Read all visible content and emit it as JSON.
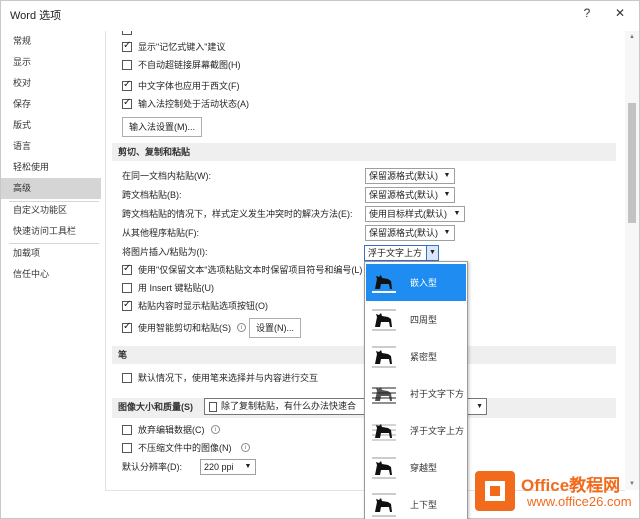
{
  "window": {
    "title": "Word 选项",
    "help": "?",
    "close": "✕"
  },
  "sidebar": {
    "items": [
      {
        "label": "常规"
      },
      {
        "label": "显示"
      },
      {
        "label": "校对"
      },
      {
        "label": "保存"
      },
      {
        "label": "版式"
      },
      {
        "label": "语言"
      },
      {
        "label": "轻松使用"
      },
      {
        "label": "高级",
        "active": true
      },
      {
        "label": "自定义功能区"
      },
      {
        "label": "快速访问工具栏"
      },
      {
        "label": "加载项"
      },
      {
        "label": "信任中心"
      }
    ]
  },
  "options": {
    "show_autocomplete": "显示\"记忆式键入\"建议",
    "no_auto_hyperlink_screenshot": "不自动超链接屏幕截图(H)",
    "chinese_font_western": "中文字体也应用于西文(F)",
    "ime_control_active": "输入法控制处于活动状态(A)",
    "ime_settings_button": "输入法设置(M)..."
  },
  "cut_copy_paste": {
    "heading": "剪切、复制和粘贴",
    "rows": [
      {
        "label": "在同一文档内粘贴(W):",
        "value": "保留源格式(默认)"
      },
      {
        "label": "跨文档粘贴(B):",
        "value": "保留源格式(默认)"
      },
      {
        "label": "跨文档粘贴的情况下，样式定义发生冲突时的解决方法(E):",
        "value": "使用目标样式(默认)"
      },
      {
        "label": "从其他程序粘贴(F):",
        "value": "保留源格式(默认)"
      }
    ],
    "insert_picture_label": "将图片插入/粘贴为(I):",
    "insert_picture_value": "浮于文字上方",
    "keep_bullets": "使用\"仅保留文本\"选项粘贴文本时保留项目符号和编号(L)",
    "insert_key_paste": "用 Insert 键粘贴(U)",
    "show_paste_options": "粘贴内容时显示粘贴选项按钮(O)",
    "smart_cut_paste": "使用智能剪切和粘贴(S)",
    "settings_button": "设置(N)..."
  },
  "pen": {
    "heading": "笔",
    "default_select": "默认情况下，使用笔来选择并与内容进行交互"
  },
  "image_size_quality": {
    "heading": "图像大小和质量(S)",
    "doc_value": "除了复制粘贴，有什么办法快速合",
    "discard_edit_data": "放弃编辑数据(C)",
    "no_compress": "不压缩文件中的图像(N)",
    "default_resolution_label": "默认分辨率(D):",
    "default_resolution_value": "220 ppi"
  },
  "wrap_dropdown": {
    "items": [
      {
        "label": "嵌入型",
        "icon": "inline-wrap-icon",
        "selected": true
      },
      {
        "label": "四周型",
        "icon": "square-wrap-icon"
      },
      {
        "label": "紧密型",
        "icon": "tight-wrap-icon"
      },
      {
        "label": "衬于文字下方",
        "icon": "behind-text-icon"
      },
      {
        "label": "浮于文字上方",
        "icon": "in-front-of-text-icon"
      },
      {
        "label": "穿越型",
        "icon": "through-wrap-icon"
      },
      {
        "label": "上下型",
        "icon": "top-bottom-wrap-icon"
      }
    ]
  },
  "watermark": {
    "line1": "Office教程网",
    "line2": "www.office26.com"
  },
  "colors": {
    "accent": "#1e8cf0",
    "brand": "#f26b1d"
  }
}
